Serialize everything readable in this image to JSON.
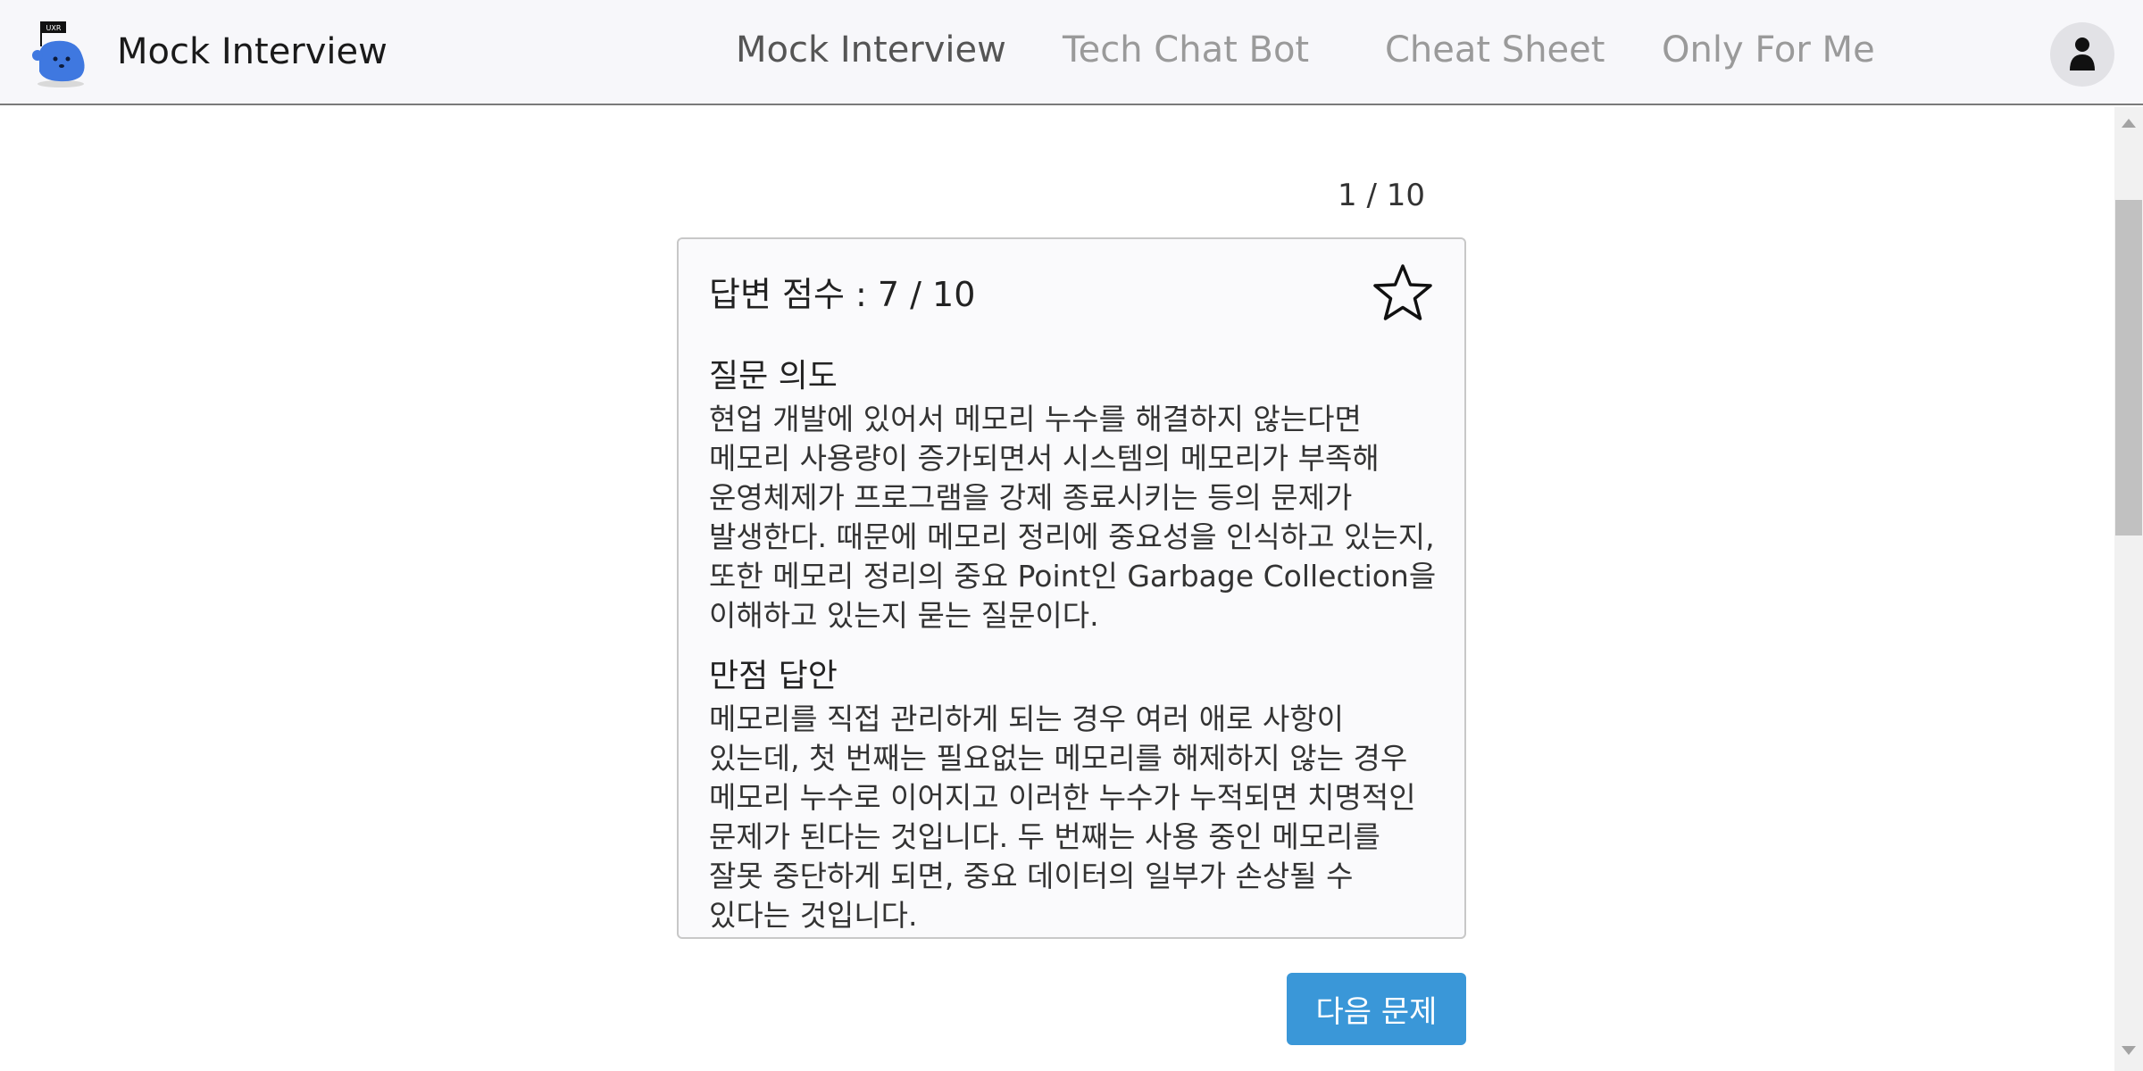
{
  "header": {
    "brand": "Mock Interview",
    "nav": [
      {
        "label": "Mock Interview"
      },
      {
        "label": "Tech Chat Bot"
      },
      {
        "label": "Cheat Sheet"
      },
      {
        "label": "Only For Me"
      }
    ],
    "logo_badge": "UXR",
    "avatar_icon": "user-icon"
  },
  "main": {
    "counter": "1 / 10",
    "score": "답변 점수 : 7 / 10",
    "star_icon": "star-outline-icon",
    "intent_title": "질문 의도",
    "intent_body": "현업 개발에 있어서 메모리 누수를 해결하지 않는다면 메모리 사용량이 증가되면서 시스템의 메모리가 부족해 운영체제가 프로그램을 강제 종료시키는 등의 문제가 발생한다. 때문에 메모리 정리에 중요성을 인식하고 있는지, 또한 메모리 정리의 중요 Point인 Garbage Collection을 이해하고 있는지 묻는 질문이다.",
    "answer_title": "만점 답안",
    "answer_body": "메모리를 직접 관리하게 되는 경우 여러 애로 사항이 있는데, 첫 번째는 필요없는 메모리를 해제하지 않는 경우 메모리 누수로 이어지고 이러한 누수가 누적되면 치명적인 문제가 된다는 것입니다. 두 번째는 사용 중인 메모리를 잘못 중단하게 되면, 중요 데이터의 일부가 손상될 수 있다는 것입니다.",
    "next_button": "다음 문제"
  },
  "colors": {
    "accent": "#3a97d8",
    "logo_blue": "#3f78e0",
    "nav_active": "#555555",
    "nav_inactive": "#9a9a9a"
  }
}
